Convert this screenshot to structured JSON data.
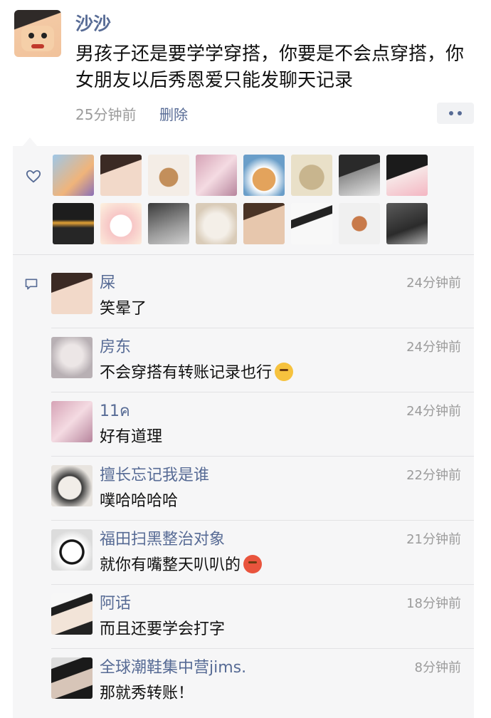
{
  "post": {
    "author": "沙沙",
    "text": "男孩子还是要学学穿搭，你要是不会点穿搭，你女朋友以后秀恩爱只能发聊天记录",
    "time": "25分钟前",
    "delete_label": "删除"
  },
  "icons": {
    "more": "more-dots-icon",
    "like": "heart-icon",
    "comment": "comment-icon"
  },
  "colors": {
    "link": "#576b95",
    "panel": "#f6f6f7",
    "meta": "#9b9b9b"
  },
  "likes_count": 16,
  "comments": [
    {
      "name": "屎",
      "text": "笑晕了",
      "time": "24分钟前"
    },
    {
      "name": "房东",
      "text": "不会穿搭有转账记录也行",
      "time": "24分钟前",
      "emoji": "smirk-emoji"
    },
    {
      "name": "11ค",
      "text": "好有道理",
      "time": "24分钟前"
    },
    {
      "name": "擅长忘记我是谁",
      "text": "噗哈哈哈哈",
      "time": "22分钟前"
    },
    {
      "name": "福田扫黑整治对象",
      "text": "就你有嘴整天叭叭的",
      "time": "21分钟前",
      "emoji": "angry-emoji"
    },
    {
      "name": "阿话",
      "text": "而且还要学会打字",
      "time": "18分钟前"
    },
    {
      "name": "全球潮鞋集中营jims.",
      "text": "那就秀转账！",
      "time": "8分钟前"
    }
  ]
}
